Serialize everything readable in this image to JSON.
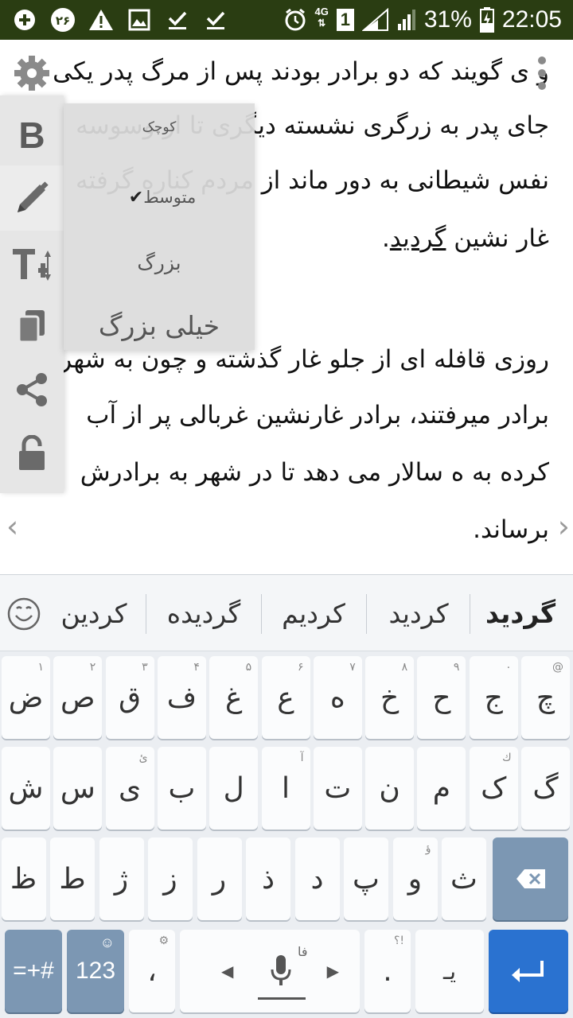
{
  "status_bar": {
    "left_icons": [
      "add-circle-icon",
      "notification-badge-icon",
      "warning-icon",
      "image-icon",
      "download-done-icon",
      "download-done-icon"
    ],
    "badge_text": "۲۶",
    "right_icons": [
      "alarm-icon",
      "network-4g-icon",
      "sim-icon",
      "signal-icon",
      "signal-icon",
      "battery-charging-icon"
    ],
    "network_label": "4G",
    "sim_label": "1",
    "battery": "31%",
    "time": "22:05"
  },
  "content": {
    "lines": [
      "و ی گویند که دو برادر بودند پس از مرگ پدر یکی",
      "جای پدر به زرگری نشسته دیگری تا از وسوسه",
      "نفس شیطانی به دور ماند از مردم کناره گرفته",
      "غار نشین",
      "گردید",
      ".",
      "روزی قافله ای از جلو غار گذشته و چون به شهر",
      "برادر میرفتند، برادر غارنشین غربالی پر از آب",
      "کرده به ه سالار می دهد تا در شهر به برادرش",
      "برساند."
    ],
    "prev_arrow": "‹",
    "next_arrow": "›"
  },
  "toolbar": {
    "items": [
      "gear-icon",
      "bold-icon",
      "pencil-icon",
      "text-size-icon",
      "copy-icon",
      "share-icon",
      "unlock-icon"
    ],
    "bold_label": "B"
  },
  "font_size_menu": {
    "options": [
      {
        "label": "کوچک",
        "selected": false
      },
      {
        "label": "متوسط",
        "selected": true
      },
      {
        "label": "بزرگ",
        "selected": false
      },
      {
        "label": "خیلی بزرگ",
        "selected": false
      }
    ],
    "check": "✔"
  },
  "keyboard": {
    "suggestions": [
      "گردید",
      "کردید",
      "کردیم",
      "گردیده",
      "کردین"
    ],
    "emoji_icon": "smiley-icon",
    "row1": [
      {
        "k": "چ",
        "h": "@"
      },
      {
        "k": "ج",
        "h": "۰"
      },
      {
        "k": "ح",
        "h": "۹"
      },
      {
        "k": "خ",
        "h": "۸"
      },
      {
        "k": "ه",
        "h": "۷"
      },
      {
        "k": "ع",
        "h": "۶"
      },
      {
        "k": "غ",
        "h": "۵"
      },
      {
        "k": "ف",
        "h": "۴"
      },
      {
        "k": "ق",
        "h": "۳"
      },
      {
        "k": "ص",
        "h": "۲"
      },
      {
        "k": "ض",
        "h": "۱"
      }
    ],
    "row2": [
      {
        "k": "گ",
        "h": ""
      },
      {
        "k": "ک",
        "h": "ك"
      },
      {
        "k": "م",
        "h": ""
      },
      {
        "k": "ن",
        "h": ""
      },
      {
        "k": "ت",
        "h": ""
      },
      {
        "k": "ا",
        "h": "آ"
      },
      {
        "k": "ل",
        "h": ""
      },
      {
        "k": "ب",
        "h": ""
      },
      {
        "k": "ی",
        "h": "ئ"
      },
      {
        "k": "س",
        "h": ""
      },
      {
        "k": "ش",
        "h": ""
      }
    ],
    "row3": [
      {
        "k": "ث",
        "h": ""
      },
      {
        "k": "و",
        "h": "ؤ"
      },
      {
        "k": "پ",
        "h": ""
      },
      {
        "k": "د",
        "h": ""
      },
      {
        "k": "ذ",
        "h": ""
      },
      {
        "k": "ر",
        "h": ""
      },
      {
        "k": "ز",
        "h": ""
      },
      {
        "k": "ژ",
        "h": ""
      },
      {
        "k": "ط",
        "h": ""
      },
      {
        "k": "ظ",
        "h": ""
      }
    ],
    "sym_label": "=+#",
    "num_label": "123",
    "comma_label": "،",
    "mic_label": "فا",
    "period_label": ".",
    "period_hint": "؟!",
    "zwnj_label": "یـ",
    "enter_label": "↵"
  }
}
